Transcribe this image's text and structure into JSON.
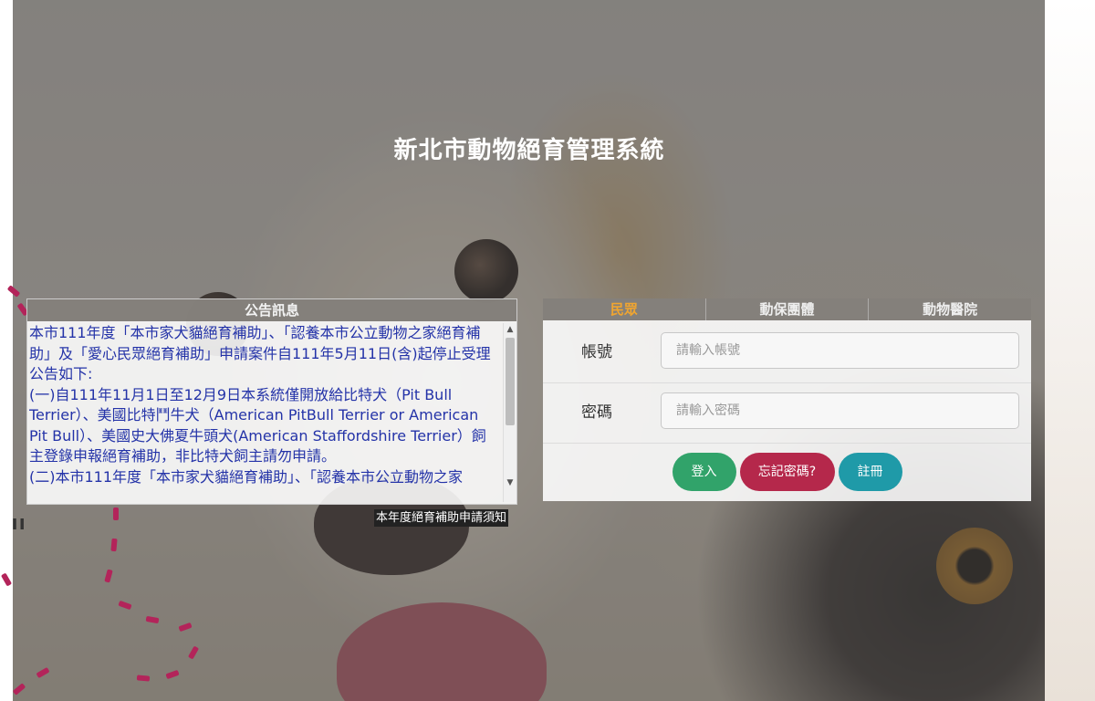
{
  "page": {
    "title": "新北市動物絕育管理系統"
  },
  "announcement": {
    "header": "公告訊息",
    "paragraphs": [
      "本市111年度「本市家犬貓絕育補助」、「認養本市公立動物之家絕育補助」及「愛心民眾絕育補助」申請案件自111年5月11日(含)起停止受理",
      "公告如下:",
      "(一)自111年11月1日至12月9日本系統僅開放給比特犬（Pit Bull Terrier）、美國比特鬥牛犬（American PitBull Terrier or American Pit Bull）、美國史大佛夏牛頭犬(American Staffordshire Terrier）飼主登錄申報絕育補助，非比特犬飼主請勿申請。",
      "(二)本市111年度「本市家犬貓絕育補助」、「認養本市公立動物之家"
    ],
    "notice_link": "本年度絕育補助申請須知"
  },
  "login": {
    "tabs": [
      {
        "label": "民眾",
        "active": true
      },
      {
        "label": "動保團體",
        "active": false
      },
      {
        "label": "動物醫院",
        "active": false
      }
    ],
    "account": {
      "label": "帳號",
      "placeholder": "請輸入帳號",
      "value": ""
    },
    "password": {
      "label": "密碼",
      "placeholder": "請輸入密碼",
      "value": ""
    },
    "buttons": {
      "login": "登入",
      "forgot": "忘記密碼?",
      "register": "註冊"
    }
  },
  "colors": {
    "active_tab": "#f0a530",
    "announcement_text": "#2433a8",
    "login_button": "#31a36a",
    "forgot_button": "#b5284b",
    "register_button": "#1f9aa8"
  },
  "icons": {
    "scroll_up": "scroll-up-arrow-icon",
    "scroll_down": "scroll-down-arrow-icon"
  }
}
